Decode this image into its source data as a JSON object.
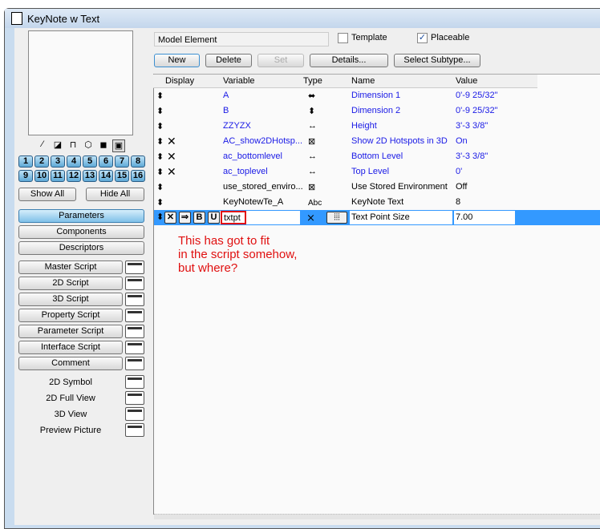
{
  "window": {
    "title": "KeyNote w Text"
  },
  "view_icons": [
    "2d-symbol-icon",
    "2d-full-icon",
    "floor-plan-icon",
    "3d-wire-icon",
    "3d-solid-icon",
    "preview-icon"
  ],
  "layers": [
    "1",
    "2",
    "3",
    "4",
    "5",
    "6",
    "7",
    "8",
    "9",
    "10",
    "11",
    "12",
    "13",
    "14",
    "15",
    "16"
  ],
  "show_all": "Show All",
  "hide_all": "Hide All",
  "sections": [
    "Parameters",
    "Components",
    "Descriptors"
  ],
  "scripts": [
    "Master Script",
    "2D Script",
    "3D Script",
    "Property Script",
    "Parameter Script",
    "Interface Script",
    "Comment"
  ],
  "views": [
    "2D Symbol",
    "2D Full View",
    "3D View",
    "Preview Picture"
  ],
  "subtype_field": "Model Element",
  "template": {
    "label": "Template",
    "checked": false
  },
  "placeable": {
    "label": "Placeable",
    "checked": true
  },
  "toolbar": {
    "new": "New",
    "delete": "Delete",
    "set": "Set",
    "details": "Details...",
    "subtype": "Select Subtype..."
  },
  "columns": [
    "Display",
    "Variable",
    "Type",
    "Name",
    "Value"
  ],
  "rows": [
    {
      "hidden": false,
      "variable": "A",
      "type": "⬌",
      "name": "Dimension 1",
      "value": "0'-9 25/32\"",
      "blue": true
    },
    {
      "hidden": false,
      "variable": "B",
      "type": "⬍",
      "name": "Dimension 2",
      "value": "0'-9 25/32\"",
      "blue": true
    },
    {
      "hidden": false,
      "variable": "ZZYZX",
      "type": "↔",
      "name": "Height",
      "value": "3'-3 3/8\"",
      "blue": true
    },
    {
      "hidden": true,
      "variable": "AC_show2DHotsp...",
      "type": "⊠",
      "name": "Show 2D Hotspots in 3D",
      "value": "On",
      "blue": true
    },
    {
      "hidden": true,
      "variable": "ac_bottomlevel",
      "type": "↔",
      "name": "Bottom Level",
      "value": "3'-3 3/8\"",
      "blue": true
    },
    {
      "hidden": true,
      "variable": "ac_toplevel",
      "type": "↔",
      "name": "Top Level",
      "value": "0'",
      "blue": true
    },
    {
      "hidden": false,
      "variable": "use_stored_enviro...",
      "type": "⊠",
      "name": "Use Stored Environment",
      "value": "Off",
      "blue": false
    },
    {
      "hidden": false,
      "variable": "KeyNotewTe_A",
      "type": "Abc",
      "name": "KeyNote Text",
      "value": "8",
      "blue": false
    }
  ],
  "selected_row": {
    "variable": "txtpt",
    "type": "⨯",
    "name": "Text Point Size",
    "value": "7.00",
    "b": "B",
    "u": "U"
  },
  "annotation": "This has got to fit\nin the script somehow,\nbut where?"
}
